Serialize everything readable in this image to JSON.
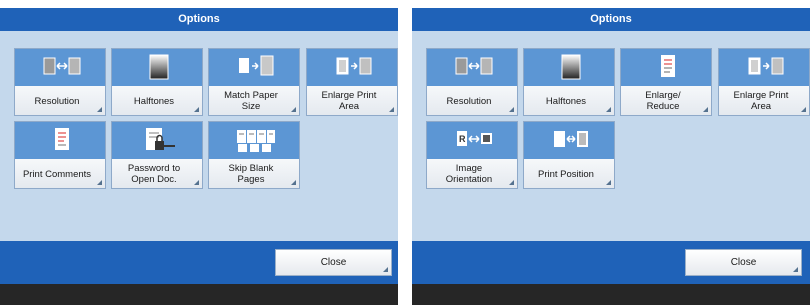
{
  "left_panel": {
    "title": "Options",
    "close_label": "Close",
    "tiles": [
      {
        "label": "Resolution",
        "icon": "resolution-icon"
      },
      {
        "label": "Halftones",
        "icon": "halftones-icon"
      },
      {
        "label": "Match Paper\nSize",
        "icon": "match-paper-size-icon"
      },
      {
        "label": "Enlarge Print\nArea",
        "icon": "enlarge-print-area-icon"
      },
      {
        "label": "Print Comments",
        "icon": "print-comments-icon"
      },
      {
        "label": "Password to\nOpen Doc.",
        "icon": "password-lock-icon"
      },
      {
        "label": "Skip Blank\nPages",
        "icon": "skip-blank-pages-icon"
      }
    ]
  },
  "right_panel": {
    "title": "Options",
    "close_label": "Close",
    "tiles": [
      {
        "label": "Resolution",
        "icon": "resolution-icon"
      },
      {
        "label": "Halftones",
        "icon": "halftones-icon"
      },
      {
        "label": "Enlarge/\nReduce",
        "icon": "enlarge-reduce-icon"
      },
      {
        "label": "Enlarge Print\nArea",
        "icon": "enlarge-print-area-icon"
      },
      {
        "label": "Image\nOrientation",
        "icon": "image-orientation-icon"
      },
      {
        "label": "Print Position",
        "icon": "print-position-icon"
      }
    ]
  },
  "colors": {
    "accent": "#1f62b8",
    "tile_top": "#5c96d4",
    "panel_bg": "#c4d8ec",
    "footer_dark": "#262626"
  }
}
